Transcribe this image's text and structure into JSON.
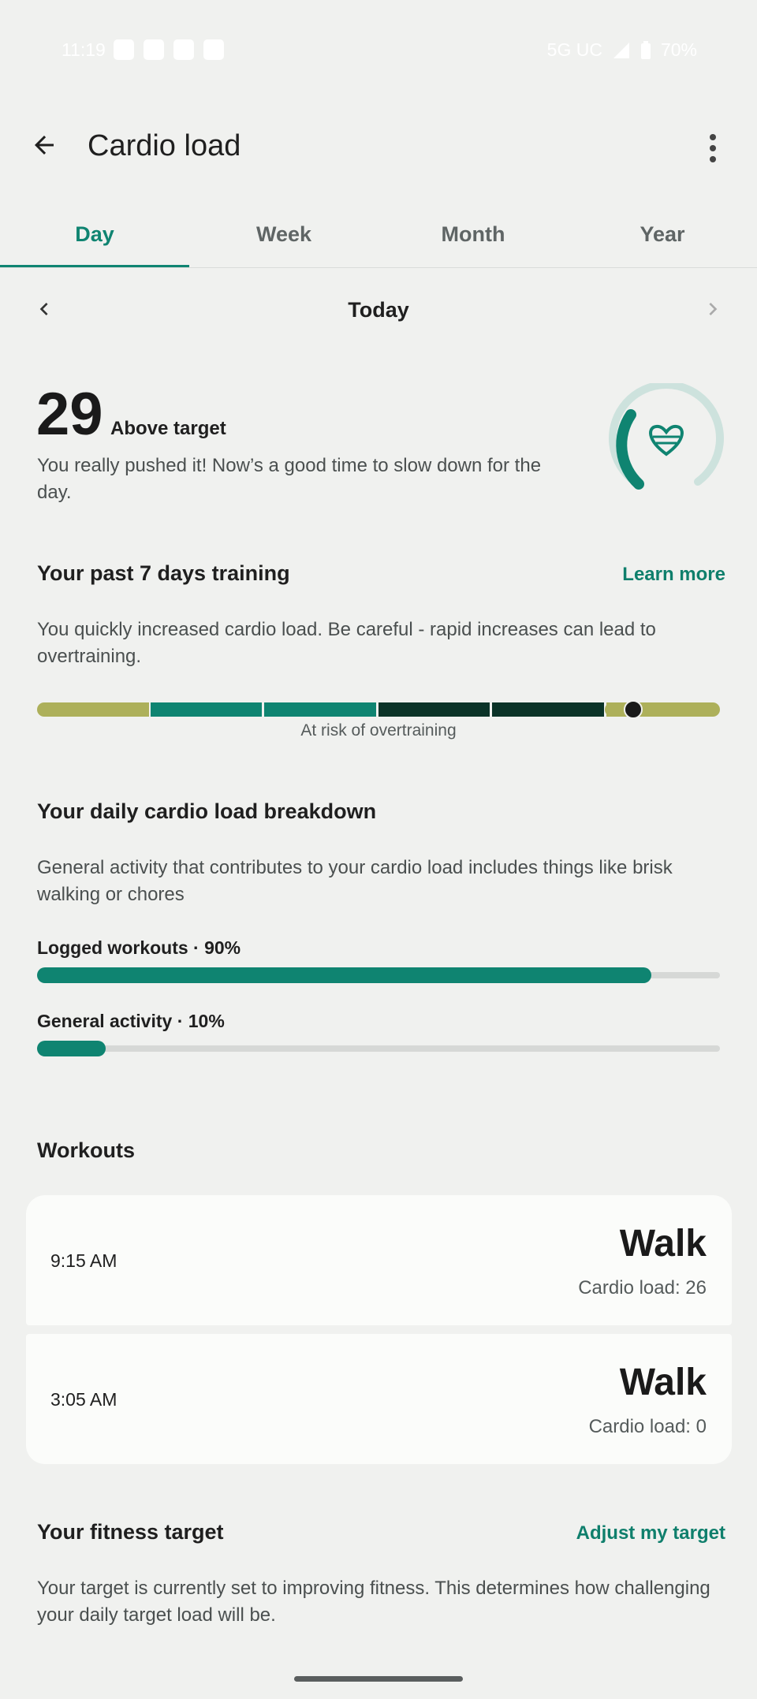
{
  "status_bar": {
    "time": "11:19",
    "network": "5G UC",
    "battery": "70%",
    "notification_icons": [
      "whatsapp-icon",
      "youtube-icon",
      "mail-icon",
      "linkedin-icon"
    ]
  },
  "app_bar": {
    "title": "Cardio load",
    "back_icon": "arrow-back-icon",
    "menu_icon": "more-vert-icon"
  },
  "tabs": [
    {
      "label": "Day",
      "active": true
    },
    {
      "label": "Week",
      "active": false
    },
    {
      "label": "Month",
      "active": false
    },
    {
      "label": "Year",
      "active": false
    }
  ],
  "date_nav": {
    "label": "Today"
  },
  "summary": {
    "score": "29",
    "status": "Above target",
    "description": "You really pushed it! Now’s a good time to slow down for the day.",
    "gauge_icon": "heart-icon"
  },
  "training": {
    "title": "Your past 7 days training",
    "learn_more": "Learn more",
    "description": "You quickly increased cardio load. Be careful - rapid increases can lead to overtraining.",
    "caption": "At risk of overtraining",
    "colors": {
      "low": "#adb05a",
      "optimal": "#0f8471",
      "high": "#0b3328"
    }
  },
  "breakdown": {
    "title": "Your daily cardio load breakdown",
    "description": "General activity that contributes to your cardio load includes things like brisk walking or chores",
    "items": [
      {
        "label": "Logged workouts · 90%",
        "fraction": 0.9
      },
      {
        "label": "General activity · 10%",
        "fraction": 0.1
      }
    ]
  },
  "workouts": {
    "title": "Workouts",
    "items": [
      {
        "time": "9:15 AM",
        "type": "Walk",
        "load": "Cardio load: 26"
      },
      {
        "time": "3:05 AM",
        "type": "Walk",
        "load": "Cardio load: 0"
      }
    ]
  },
  "fitness_target": {
    "title": "Your fitness target",
    "adjust": "Adjust my target",
    "description": "Your target is currently set to improving fitness. This determines how challenging your daily target load will be."
  },
  "accent_color": "#0f8471"
}
